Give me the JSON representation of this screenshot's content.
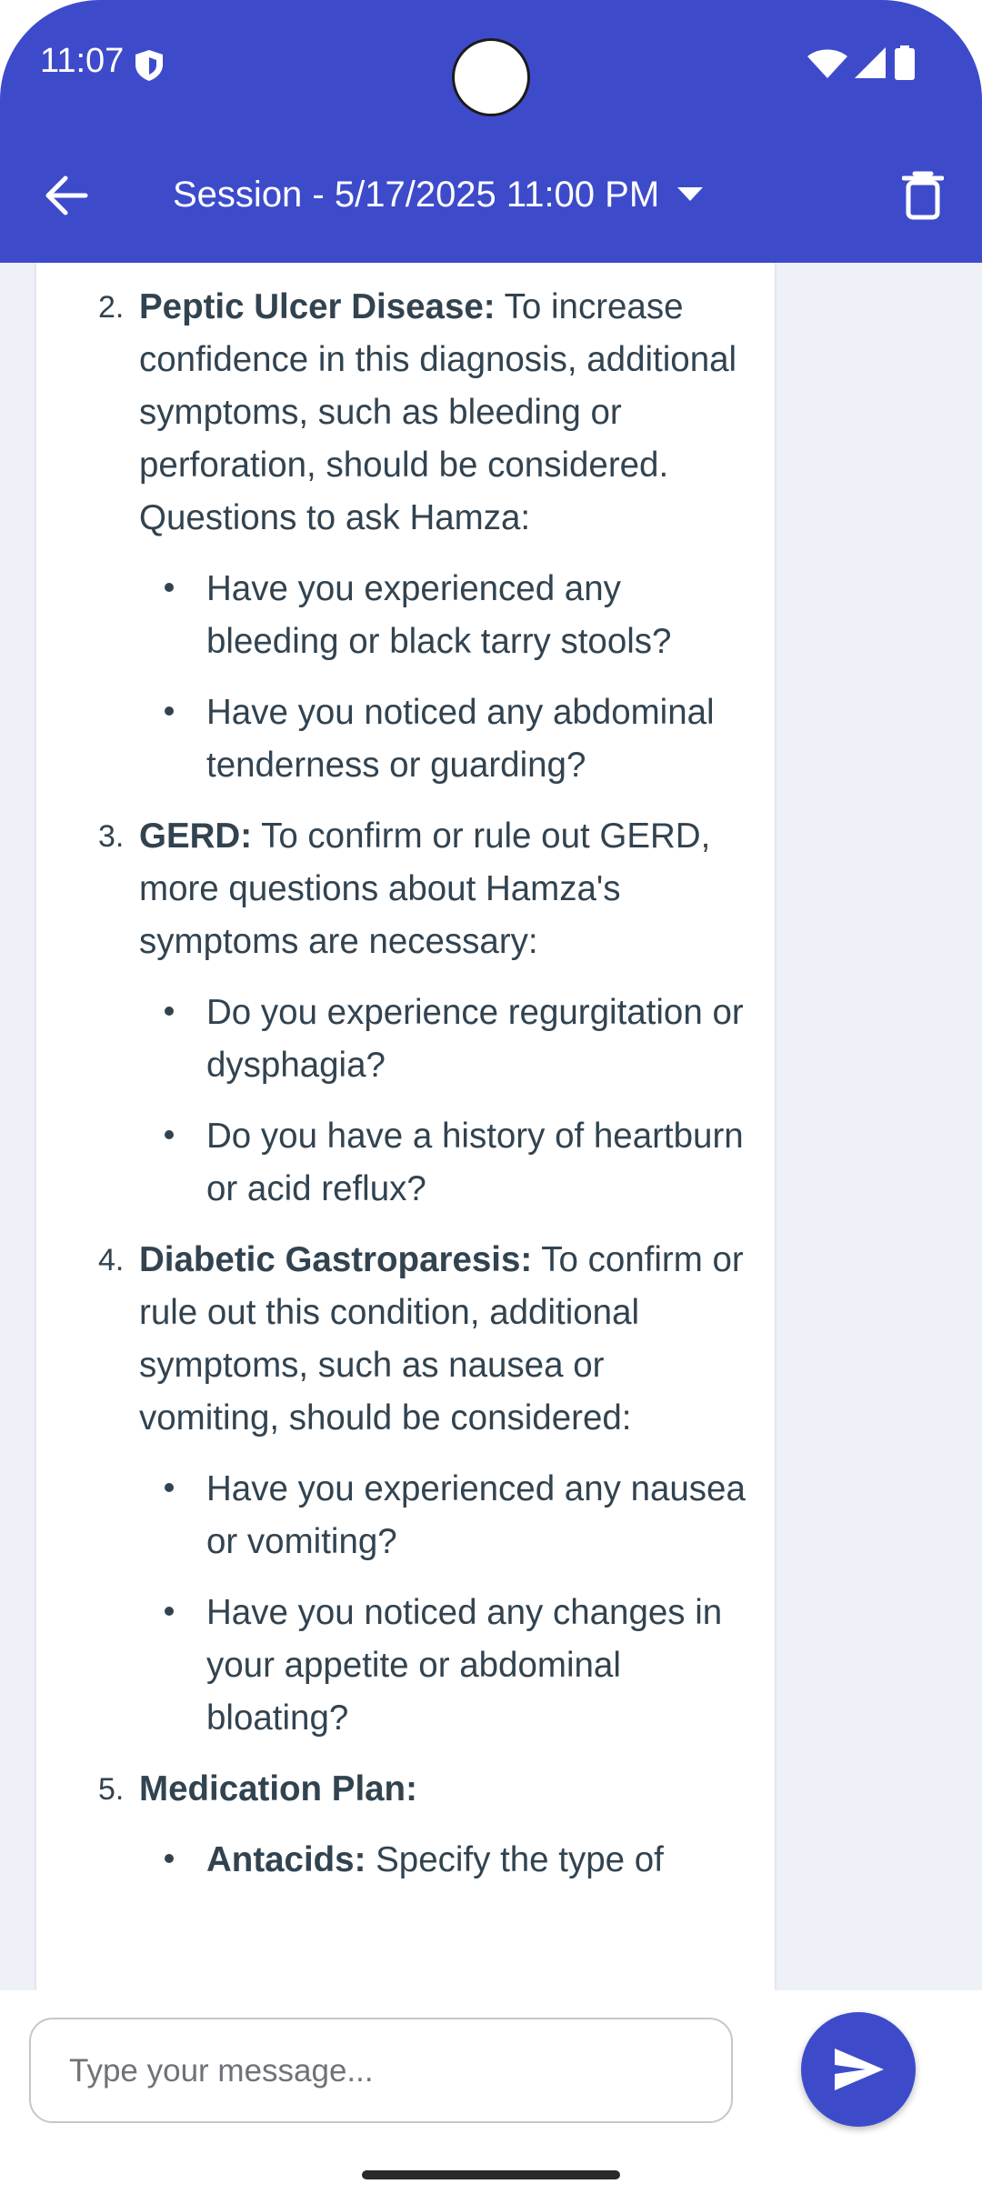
{
  "status_bar": {
    "time": "11:07"
  },
  "app_bar": {
    "title": "Session - 5/17/2025 11:00 PM"
  },
  "message": {
    "items": [
      {
        "number": "2.",
        "label": "Peptic Ulcer Disease:",
        "text": " To increase confidence in this diagnosis, additional symptoms, such as bleeding or perforation, should be considered. Questions to ask Hamza:",
        "bullets": [
          {
            "text": "Have you experienced any bleeding or black tarry stools?"
          },
          {
            "text": "Have you noticed any abdominal tenderness or guarding?"
          }
        ]
      },
      {
        "number": "3.",
        "label": "GERD:",
        "text": " To confirm or rule out GERD, more questions about Hamza's symptoms are necessary:",
        "bullets": [
          {
            "text": "Do you experience regurgitation or dysphagia?"
          },
          {
            "text": "Do you have a history of heartburn or acid reflux?"
          }
        ]
      },
      {
        "number": "4.",
        "label": "Diabetic Gastroparesis:",
        "text": " To confirm or rule out this condition, additional symptoms, such as nausea or vomiting, should be considered:",
        "bullets": [
          {
            "text": "Have you experienced any nausea or vomiting?"
          },
          {
            "text": "Have you noticed any changes in your appetite or abdominal bloating?"
          }
        ]
      },
      {
        "number": "5.",
        "label": "Medication Plan:",
        "text": "",
        "bullets": [
          {
            "label": "Antacids:",
            "text": " Specify the type of"
          }
        ]
      }
    ]
  },
  "composer": {
    "placeholder": "Type your message..."
  },
  "colors": {
    "primary": "#3d4bcb",
    "text": "#324350",
    "background": "#eef1f7"
  },
  "icons": [
    "shield-icon",
    "wifi-icon",
    "signal-icon",
    "battery-icon",
    "back-arrow-icon",
    "caret-down-icon",
    "trash-icon",
    "send-icon"
  ]
}
